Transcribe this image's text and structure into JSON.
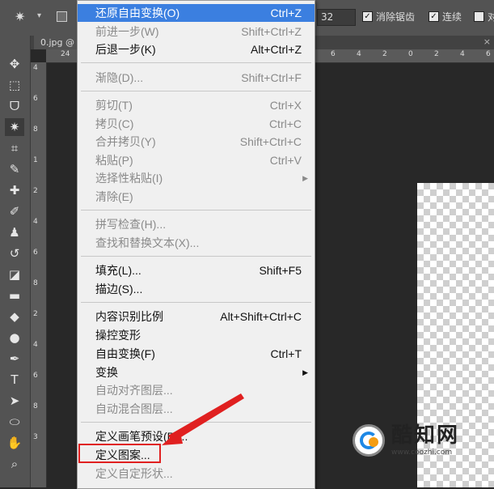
{
  "options_bar": {
    "tool_icon": "magic-wand-icon",
    "tolerance_value": "32",
    "antialias_label": "消除锯齿",
    "contiguous_label": "连续",
    "trailing_label": "对"
  },
  "document_tab": {
    "label": "0.jpg @",
    "close": "×"
  },
  "ruler": {
    "h_labels": [
      "24",
      "6",
      "4",
      "2",
      "0",
      "2",
      "4",
      "6"
    ],
    "v_labels": [
      "4",
      "6",
      "8",
      "1",
      "2",
      "4",
      "6",
      "8",
      "2",
      "4",
      "6",
      "8",
      "3"
    ]
  },
  "toolbox": [
    "move-icon",
    "marquee-icon",
    "lasso-icon",
    "magic-wand-icon",
    "crop-icon",
    "eyedropper-icon",
    "healing-brush-icon",
    "brush-icon",
    "clone-stamp-icon",
    "history-brush-icon",
    "eraser-icon",
    "gradient-icon",
    "blur-icon",
    "dodge-icon",
    "pen-icon",
    "type-icon",
    "path-selection-icon",
    "shape-icon",
    "hand-icon",
    "zoom-icon"
  ],
  "edit_menu": {
    "items": [
      {
        "label": "还原自由变换(O)",
        "shortcut": "Ctrl+Z",
        "state": "highlighted"
      },
      {
        "label": "前进一步(W)",
        "shortcut": "Shift+Ctrl+Z",
        "state": "disabled"
      },
      {
        "label": "后退一步(K)",
        "shortcut": "Alt+Ctrl+Z",
        "state": "enabled"
      },
      {
        "label": "渐隐(D)...",
        "shortcut": "Shift+Ctrl+F",
        "state": "disabled"
      },
      {
        "label": "剪切(T)",
        "shortcut": "Ctrl+X",
        "state": "disabled"
      },
      {
        "label": "拷贝(C)",
        "shortcut": "Ctrl+C",
        "state": "disabled"
      },
      {
        "label": "合并拷贝(Y)",
        "shortcut": "Shift+Ctrl+C",
        "state": "disabled"
      },
      {
        "label": "粘贴(P)",
        "shortcut": "Ctrl+V",
        "state": "disabled"
      },
      {
        "label": "选择性粘贴(I)",
        "shortcut": "",
        "state": "disabled"
      },
      {
        "label": "清除(E)",
        "shortcut": "",
        "state": "disabled"
      },
      {
        "label": "拼写检查(H)...",
        "shortcut": "",
        "state": "disabled"
      },
      {
        "label": "查找和替换文本(X)...",
        "shortcut": "",
        "state": "disabled"
      },
      {
        "label": "填充(L)...",
        "shortcut": "Shift+F5",
        "state": "enabled"
      },
      {
        "label": "描边(S)...",
        "shortcut": "",
        "state": "enabled"
      },
      {
        "label": "内容识别比例",
        "shortcut": "Alt+Shift+Ctrl+C",
        "state": "enabled"
      },
      {
        "label": "操控变形",
        "shortcut": "",
        "state": "enabled"
      },
      {
        "label": "自由变换(F)",
        "shortcut": "Ctrl+T",
        "state": "enabled"
      },
      {
        "label": "变换",
        "shortcut": "",
        "state": "enabled"
      },
      {
        "label": "自动对齐图层...",
        "shortcut": "",
        "state": "disabled"
      },
      {
        "label": "自动混合图层...",
        "shortcut": "",
        "state": "disabled"
      },
      {
        "label": "定义画笔预设(B)...",
        "shortcut": "",
        "state": "enabled"
      },
      {
        "label": "定义图案...",
        "shortcut": "",
        "state": "enabled"
      },
      {
        "label": "定义自定形状...",
        "shortcut": "",
        "state": "disabled"
      }
    ]
  },
  "watermark": {
    "name": "酷知网",
    "url": "www.coozhi.com"
  },
  "colors": {
    "highlight": "#3b7fe0",
    "annotation": "#e02020",
    "menu_bg": "#f0f0f0",
    "disabled_text": "#8a8a8a"
  }
}
